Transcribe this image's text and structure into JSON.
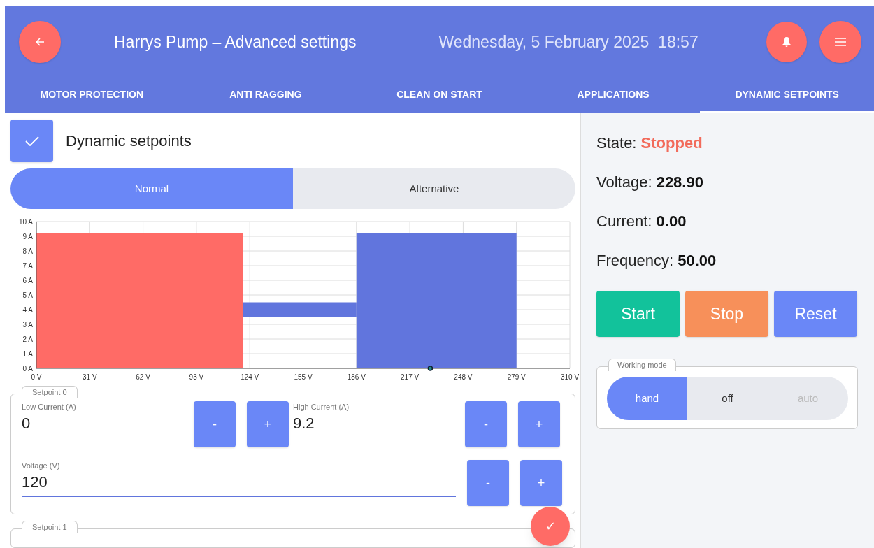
{
  "header": {
    "title": "Harrys Pump – Advanced settings",
    "datetime": "Wednesday, 5 February 2025  18:57"
  },
  "tabs": [
    {
      "label": "MOTOR PROTECTION",
      "selected": false
    },
    {
      "label": "ANTI RAGGING",
      "selected": false
    },
    {
      "label": "CLEAN ON START",
      "selected": false
    },
    {
      "label": "APPLICATIONS",
      "selected": false
    },
    {
      "label": "DYNAMIC SETPOINTS",
      "selected": true
    }
  ],
  "enable": {
    "label": "Dynamic setpoints",
    "checked": true
  },
  "profile_toggle": [
    {
      "label": "Normal",
      "selected": true
    },
    {
      "label": "Alternative",
      "selected": false
    }
  ],
  "chart_data": {
    "type": "area",
    "x": [
      0,
      120,
      186,
      279
    ],
    "series": [
      {
        "color": "#ff6b66",
        "values": [
          9.2,
          9.2,
          null,
          null
        ]
      },
      {
        "color": "#6175dd",
        "values": [
          null,
          null,
          9.2,
          9.2
        ]
      }
    ],
    "grid": true,
    "xlim": [
      0,
      310
    ],
    "ylim": [
      0,
      10
    ],
    "xticks": [
      {
        "value": 0,
        "label": "0 V"
      },
      {
        "value": 31,
        "label": "31 V"
      },
      {
        "value": 62,
        "label": "62 V"
      },
      {
        "value": 93,
        "label": "93 V"
      },
      {
        "value": 124,
        "label": "124 V"
      },
      {
        "value": 155,
        "label": "155 V"
      },
      {
        "value": 186,
        "label": "186 V"
      },
      {
        "value": 217,
        "label": "217 V"
      },
      {
        "value": 248,
        "label": "248 V"
      },
      {
        "value": 279,
        "label": "279 V"
      },
      {
        "value": 310,
        "label": "310 V"
      }
    ],
    "yticks": [
      {
        "value": 0,
        "label": "0 A"
      },
      {
        "value": 1,
        "label": "1 A"
      },
      {
        "value": 2,
        "label": "2 A"
      },
      {
        "value": 3,
        "label": "3 A"
      },
      {
        "value": 4,
        "label": "4 A"
      },
      {
        "value": 5,
        "label": "5 A"
      },
      {
        "value": 6,
        "label": "6 A"
      },
      {
        "value": 7,
        "label": "7 A"
      },
      {
        "value": 8,
        "label": "8 A"
      },
      {
        "value": 9,
        "label": "9 A"
      },
      {
        "value": 10,
        "label": "10 A"
      }
    ]
  },
  "setpoints": [
    {
      "title": "Setpoint 0",
      "low_current": {
        "label": "Low Current (A)",
        "value": "0"
      },
      "high_current": {
        "label": "High Current (A)",
        "value": "9.2"
      },
      "voltage": {
        "label": "Voltage (V)",
        "value": "120"
      },
      "minus": "-",
      "plus": "+"
    },
    {
      "title": "Setpoint 1"
    }
  ],
  "save_button": {
    "symbol": "✓"
  },
  "status": [
    {
      "label": "State:",
      "value": "Stopped",
      "kind": "alert"
    },
    {
      "label": "Voltage:",
      "value": "228.90",
      "kind": "plain"
    },
    {
      "label": "Current:",
      "value": "0.00",
      "kind": "plain"
    },
    {
      "label": "Frequency:",
      "value": "50.00",
      "kind": "plain"
    }
  ],
  "actions": [
    {
      "label": "Start",
      "color": "#12c29b"
    },
    {
      "label": "Stop",
      "color": "#f7905a"
    },
    {
      "label": "Reset",
      "color": "#6a87f7"
    }
  ],
  "working_mode": {
    "title": "Working mode",
    "options": [
      {
        "label": "hand",
        "selected": true,
        "disabled": false
      },
      {
        "label": "off",
        "selected": false,
        "disabled": false
      },
      {
        "label": "auto",
        "selected": false,
        "disabled": true
      }
    ]
  }
}
